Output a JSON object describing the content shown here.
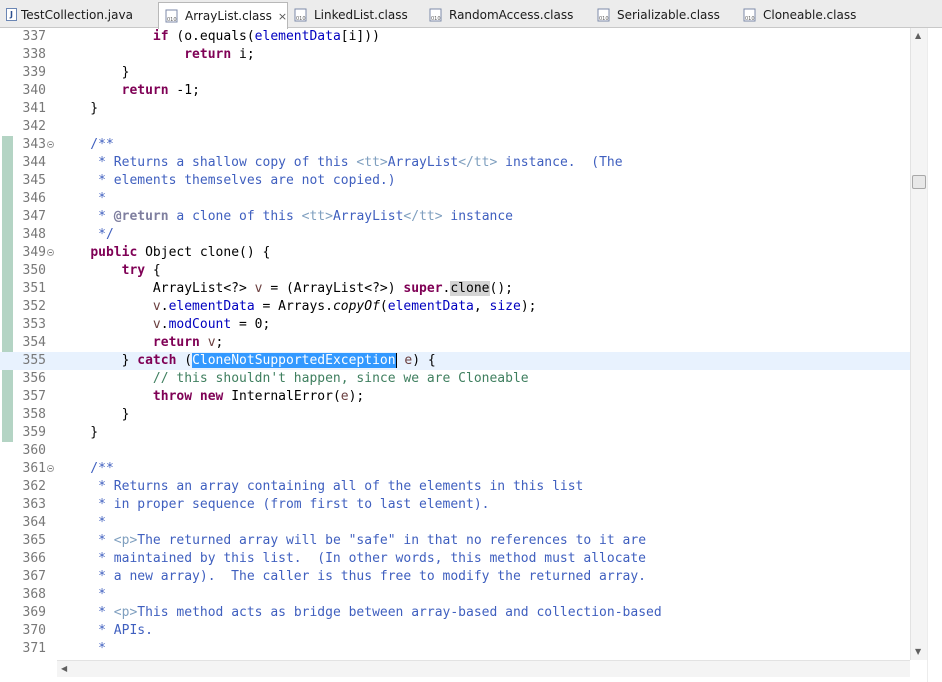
{
  "tabs": [
    {
      "label": "TestCollection.java",
      "icon": "java-file-icon",
      "active": false
    },
    {
      "label": "ArrayList.class",
      "icon": "class-file-icon",
      "active": true,
      "close": "×"
    },
    {
      "label": "LinkedList.class",
      "icon": "class-file-icon",
      "active": false
    },
    {
      "label": "RandomAccess.class",
      "icon": "class-file-icon",
      "active": false
    },
    {
      "label": "Serializable.class",
      "icon": "class-file-icon",
      "active": false
    },
    {
      "label": "Cloneable.class",
      "icon": "class-file-icon",
      "active": false
    }
  ],
  "java_icon_glyph": "J",
  "class_icon_text": "010",
  "current_line": 355,
  "fold_lines": [
    343,
    349,
    361
  ],
  "lines": [
    {
      "n": 337,
      "tokens": [
        [
          "",
          "            "
        ],
        [
          "kw",
          "if"
        ],
        [
          "",
          " (o.equals("
        ],
        [
          "fld",
          "elementData"
        ],
        [
          "",
          "[i]))"
        ]
      ]
    },
    {
      "n": 338,
      "tokens": [
        [
          "",
          "                "
        ],
        [
          "kw",
          "return"
        ],
        [
          "",
          " i;"
        ]
      ]
    },
    {
      "n": 339,
      "tokens": [
        [
          "",
          "        }"
        ]
      ]
    },
    {
      "n": 340,
      "tokens": [
        [
          "",
          "        "
        ],
        [
          "kw",
          "return"
        ],
        [
          "",
          " -1;"
        ]
      ]
    },
    {
      "n": 341,
      "tokens": [
        [
          "",
          "    }"
        ]
      ]
    },
    {
      "n": 342,
      "tokens": []
    },
    {
      "n": 343,
      "tokens": [
        [
          "jd",
          "    /**"
        ]
      ]
    },
    {
      "n": 344,
      "tokens": [
        [
          "jd",
          "     * Returns a shallow copy of this "
        ],
        [
          "jdtag",
          "<tt>"
        ],
        [
          "jd",
          "ArrayList"
        ],
        [
          "jdtag",
          "</tt>"
        ],
        [
          "jd",
          " instance.  (The"
        ]
      ]
    },
    {
      "n": 345,
      "tokens": [
        [
          "jd",
          "     * elements themselves are not copied.)"
        ]
      ]
    },
    {
      "n": 346,
      "tokens": [
        [
          "jd",
          "     *"
        ]
      ]
    },
    {
      "n": 347,
      "tokens": [
        [
          "jd",
          "     * "
        ],
        [
          "jdkw",
          "@return"
        ],
        [
          "jd",
          " a clone of this "
        ],
        [
          "jdtag",
          "<tt>"
        ],
        [
          "jd",
          "ArrayList"
        ],
        [
          "jdtag",
          "</tt>"
        ],
        [
          "jd",
          " instance"
        ]
      ]
    },
    {
      "n": 348,
      "tokens": [
        [
          "jd",
          "     */"
        ]
      ]
    },
    {
      "n": 349,
      "tokens": [
        [
          "",
          "    "
        ],
        [
          "kw",
          "public"
        ],
        [
          "",
          " Object clone() {"
        ]
      ]
    },
    {
      "n": 350,
      "tokens": [
        [
          "",
          "        "
        ],
        [
          "kw",
          "try"
        ],
        [
          "",
          " {"
        ]
      ]
    },
    {
      "n": 351,
      "tokens": [
        [
          "",
          "            ArrayList<?> "
        ],
        [
          "lv",
          "v"
        ],
        [
          "",
          " = (ArrayList<?>) "
        ],
        [
          "kw",
          "super"
        ],
        [
          "",
          "."
        ],
        [
          "occ",
          "clone"
        ],
        [
          "",
          "();"
        ]
      ]
    },
    {
      "n": 352,
      "tokens": [
        [
          "",
          "            "
        ],
        [
          "lv",
          "v"
        ],
        [
          "",
          "."
        ],
        [
          "fld",
          "elementData"
        ],
        [
          "",
          " = Arrays."
        ],
        [
          "it",
          "copyOf"
        ],
        [
          "",
          "("
        ],
        [
          "fld",
          "elementData"
        ],
        [
          "",
          ", "
        ],
        [
          "fld",
          "size"
        ],
        [
          "",
          ");"
        ]
      ]
    },
    {
      "n": 353,
      "tokens": [
        [
          "",
          "            "
        ],
        [
          "lv",
          "v"
        ],
        [
          "",
          "."
        ],
        [
          "fld",
          "modCount"
        ],
        [
          "",
          " = 0;"
        ]
      ]
    },
    {
      "n": 354,
      "tokens": [
        [
          "",
          "            "
        ],
        [
          "kw",
          "return"
        ],
        [
          "",
          " "
        ],
        [
          "lv",
          "v"
        ],
        [
          "",
          ";"
        ]
      ]
    },
    {
      "n": 355,
      "tokens": [
        [
          "",
          "        } "
        ],
        [
          "kw",
          "catch"
        ],
        [
          "",
          " ("
        ],
        [
          "sel",
          "CloneNotSupportedException"
        ],
        [
          "caret",
          ""
        ],
        [
          "",
          " "
        ],
        [
          "lv",
          "e"
        ],
        [
          "",
          ") {"
        ]
      ]
    },
    {
      "n": 356,
      "tokens": [
        [
          "",
          "            "
        ],
        [
          "cm",
          "// this shouldn't happen, since we are Cloneable"
        ]
      ]
    },
    {
      "n": 357,
      "tokens": [
        [
          "",
          "            "
        ],
        [
          "kw",
          "throw"
        ],
        [
          "",
          " "
        ],
        [
          "kw",
          "new"
        ],
        [
          "",
          " InternalError("
        ],
        [
          "lv",
          "e"
        ],
        [
          "",
          ");"
        ]
      ]
    },
    {
      "n": 358,
      "tokens": [
        [
          "",
          "        }"
        ]
      ]
    },
    {
      "n": 359,
      "tokens": [
        [
          "",
          "    }"
        ]
      ]
    },
    {
      "n": 360,
      "tokens": []
    },
    {
      "n": 361,
      "tokens": [
        [
          "jd",
          "    /**"
        ]
      ]
    },
    {
      "n": 362,
      "tokens": [
        [
          "jd",
          "     * Returns an array containing all of the elements in this list"
        ]
      ]
    },
    {
      "n": 363,
      "tokens": [
        [
          "jd",
          "     * in proper sequence (from first to last element)."
        ]
      ]
    },
    {
      "n": 364,
      "tokens": [
        [
          "jd",
          "     *"
        ]
      ]
    },
    {
      "n": 365,
      "tokens": [
        [
          "jd",
          "     * "
        ],
        [
          "jdtag",
          "<p>"
        ],
        [
          "jd",
          "The returned array will be \"safe\" in that no references to it are"
        ]
      ]
    },
    {
      "n": 366,
      "tokens": [
        [
          "jd",
          "     * maintained by this list.  (In other words, this method must allocate"
        ]
      ]
    },
    {
      "n": 367,
      "tokens": [
        [
          "jd",
          "     * a new array).  The caller is thus free to modify the returned array."
        ]
      ]
    },
    {
      "n": 368,
      "tokens": [
        [
          "jd",
          "     *"
        ]
      ]
    },
    {
      "n": 369,
      "tokens": [
        [
          "jd",
          "     * "
        ],
        [
          "jdtag",
          "<p>"
        ],
        [
          "jd",
          "This method acts as bridge between array-based and collection-based"
        ]
      ]
    },
    {
      "n": 370,
      "tokens": [
        [
          "jd",
          "     * APIs."
        ]
      ]
    },
    {
      "n": 371,
      "tokens": [
        [
          "jd",
          "     *"
        ]
      ]
    }
  ]
}
